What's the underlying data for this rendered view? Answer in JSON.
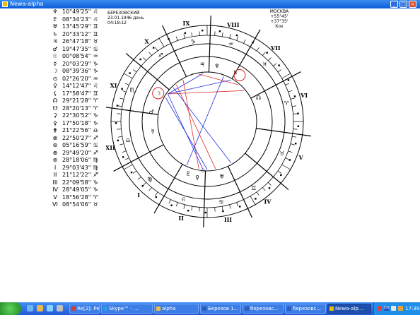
{
  "window": {
    "title": "Newa-alpha",
    "min_label": "_",
    "max_label": "□",
    "close_label": "×"
  },
  "planets": [
    {
      "glyph": "♆",
      "pos": "10°49'25''",
      "sign": "♌"
    },
    {
      "glyph": "♇",
      "pos": "08°34'23''",
      "sign": "♌"
    },
    {
      "glyph": "♅",
      "pos": "13°45'29''",
      "sign": "♊"
    },
    {
      "glyph": "♄",
      "pos": "20°33'12''",
      "sign": "♊"
    },
    {
      "glyph": "♃",
      "pos": "26°47'18''",
      "sign": "♉"
    },
    {
      "glyph": "♂",
      "pos": "19°47'35''",
      "sign": "♋"
    },
    {
      "glyph": "☉",
      "pos": "00°08'54''",
      "sign": "♒"
    },
    {
      "glyph": "☿",
      "pos": "20°03'29''",
      "sign": "♑"
    },
    {
      "glyph": "☽",
      "pos": "08°39'36''",
      "sign": "♑"
    },
    {
      "glyph": "⊙",
      "pos": "02°26'20''",
      "sign": "♒"
    },
    {
      "glyph": "♀",
      "pos": "14°12'47''",
      "sign": "♌"
    },
    {
      "glyph": "⚸",
      "pos": "17°58'47''",
      "sign": "♊"
    },
    {
      "glyph": "☊",
      "pos": "29°21'28''",
      "sign": "♈"
    },
    {
      "glyph": "☋",
      "pos": "28°20'13''",
      "sign": "♈"
    },
    {
      "glyph": "⚳",
      "pos": "22°30'52''",
      "sign": "♑"
    },
    {
      "glyph": "⚴",
      "pos": "17°50'18''",
      "sign": "♑"
    },
    {
      "glyph": "⚵",
      "pos": "21°22'56''",
      "sign": "♎"
    },
    {
      "glyph": "⊗",
      "pos": "22°50'27''",
      "sign": "♐"
    },
    {
      "glyph": "⊛",
      "pos": "05°16'59''",
      "sign": "♋"
    },
    {
      "glyph": "⊕",
      "pos": "29°49'20''",
      "sign": "♐"
    },
    {
      "glyph": "⊚",
      "pos": "28°18'06''",
      "sign": "♍"
    },
    {
      "glyph": "I",
      "pos": "29°03'43''",
      "sign": "♍"
    },
    {
      "glyph": "II",
      "pos": "21°12'22''",
      "sign": "♐"
    },
    {
      "glyph": "III",
      "pos": "22°09'58''",
      "sign": "♑"
    },
    {
      "glyph": "IV",
      "pos": "28°49'05''",
      "sign": "♑"
    },
    {
      "glyph": "V",
      "pos": "18°56'28''",
      "sign": "♈"
    },
    {
      "glyph": "VI",
      "pos": "08°54'06''",
      "sign": "♉"
    }
  ],
  "natal": {
    "name": "БЕРЕЗОВСКИЙ",
    "date": "23.01.1946 день",
    "time": "04:18:12"
  },
  "place": {
    "city": "МОСКВА",
    "coords": "+55°45' +37°35'",
    "system": "Кох"
  },
  "chart": {
    "house_numerals": [
      "IX",
      "VIII",
      "VII",
      "VI",
      "V",
      "IV",
      "III",
      "II",
      "I",
      "XII",
      "XI",
      "X"
    ],
    "sign_glyphs": [
      "♑",
      "♒",
      "♓",
      "♈",
      "♉",
      "♊",
      "♋",
      "♌",
      "♍",
      "♎",
      "♏",
      "♐"
    ],
    "inner_glyphs": [
      "☽",
      "♃",
      "♆",
      "♄",
      "☊",
      "♂",
      "☿",
      "♀",
      "☉",
      "♅",
      "♇"
    ]
  },
  "taskbar": {
    "start_label": "",
    "items": [
      {
        "label": "Re[2]: Per...",
        "active": false,
        "icon_color": "#d83c2f"
      },
      {
        "label": "Skype™ - ...",
        "active": false,
        "icon_color": "#2a9fe0"
      },
      {
        "label": "alpha",
        "active": false,
        "icon_color": "#f0c040"
      },
      {
        "label": "Березов 1...",
        "active": false,
        "icon_color": "#2b5fb8"
      },
      {
        "label": "березовс...",
        "active": false,
        "icon_color": "#2b5fb8"
      },
      {
        "label": "березовс...",
        "active": false,
        "icon_color": "#2b5fb8"
      },
      {
        "label": "Newa-alp...",
        "active": true,
        "icon_color": "#e8c000"
      }
    ],
    "tray": {
      "lang": "EN",
      "time": "17:39"
    }
  }
}
